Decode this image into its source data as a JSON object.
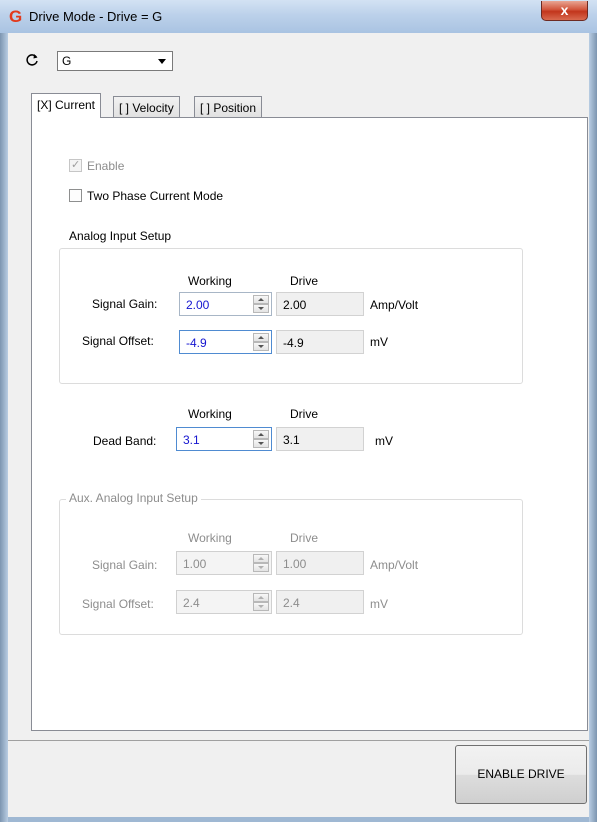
{
  "window": {
    "title": "Drive Mode - Drive = G",
    "app_icon": "G",
    "close_label": "x"
  },
  "toolbar": {
    "refresh_icon": "refresh-icon",
    "drive_select_value": "G"
  },
  "tabs": [
    {
      "label": "[X] Current",
      "active": true
    },
    {
      "label": "[ ] Velocity",
      "active": false
    },
    {
      "label": "[ ] Position",
      "active": false
    }
  ],
  "current": {
    "enable_label": "Enable",
    "enable_checked": true,
    "two_phase_label": "Two Phase Current Mode",
    "two_phase_checked": false,
    "analog_setup": {
      "title": "Analog Input Setup",
      "col_working": "Working",
      "col_drive": "Drive",
      "signal_gain_label": "Signal Gain:",
      "signal_gain_working": "2.00",
      "signal_gain_drive": "2.00",
      "signal_gain_unit": "Amp/Volt",
      "signal_offset_label": "Signal Offset:",
      "signal_offset_working": "-4.9",
      "signal_offset_drive": "-4.9",
      "signal_offset_unit": "mV"
    },
    "dead_band": {
      "col_working": "Working",
      "col_drive": "Drive",
      "label": "Dead Band:",
      "working": "3.1",
      "drive": "3.1",
      "unit": "mV"
    },
    "aux_setup": {
      "title": "Aux. Analog Input Setup",
      "col_working": "Working",
      "col_drive": "Drive",
      "signal_gain_label": "Signal Gain:",
      "signal_gain_working": "1.00",
      "signal_gain_drive": "1.00",
      "signal_gain_unit": "Amp/Volt",
      "signal_offset_label": "Signal Offset:",
      "signal_offset_working": "2.4",
      "signal_offset_drive": "2.4",
      "signal_offset_unit": "mV"
    }
  },
  "footer": {
    "enable_drive_label": "ENABLE DRIVE"
  },
  "colors": {
    "accent_value": "#1515d0",
    "disabled_text": "#8d8d8d",
    "brand_icon": "#e23a1c"
  }
}
